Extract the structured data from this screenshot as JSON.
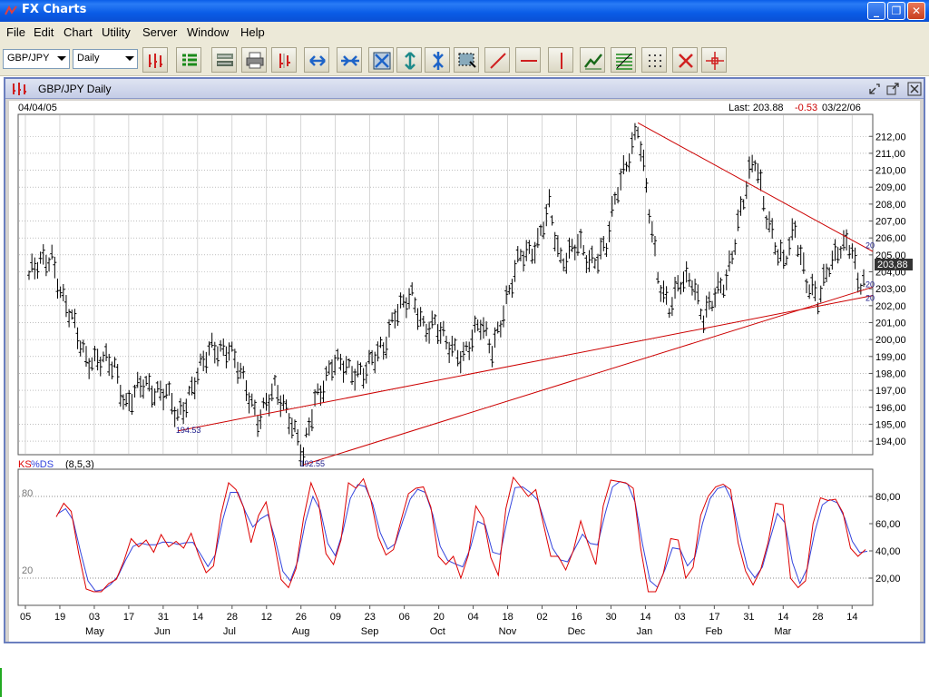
{
  "window": {
    "title": "FX Charts",
    "buttons": [
      "_",
      "❐",
      "✕"
    ]
  },
  "menu": [
    "File",
    "Edit",
    "Chart",
    "Utility",
    "Server",
    "Window",
    "Help"
  ],
  "toolbar": {
    "symbol": "GBP/JPY",
    "period": "Daily",
    "buttons": [
      "bar-chart",
      "list",
      "layout",
      "print",
      "bars",
      "expand-horizontal",
      "compress-horizontal",
      "zoom-fit",
      "expand-vertical",
      "compress-vertical",
      "select-region",
      "trend-line",
      "horizontal-line",
      "vertical-line",
      "indicator",
      "fibonacci",
      "grid",
      "delete",
      "crosshair"
    ]
  },
  "document": {
    "title": "GBP/JPY Daily"
  },
  "chart_header": {
    "start_date": "04/04/05",
    "last_label": "Last: 203.88",
    "change": "-0.53",
    "end_date": "03/22/06"
  },
  "colors": {
    "price_bars": "#000000",
    "trendlines": "#cc0000",
    "ks_line": "#dd0000",
    "ds_line": "#3344dd",
    "grid": "#999999",
    "last_box": "#333333",
    "window_border": "#6b7fbf"
  },
  "chart_data": [
    {
      "type": "ohlc",
      "title": "GBP/JPY Daily",
      "y_axis": {
        "ylim": [
          193.2,
          213.3
        ],
        "tick_labels": [
          "194,00",
          "195,00",
          "196,00",
          "197,00",
          "198,00",
          "199,00",
          "200,00",
          "201,00",
          "202,00",
          "203,00",
          "204,00",
          "205,00",
          "206,00",
          "207,00",
          "208,00",
          "209,00",
          "210,00",
          "211,00",
          "212,00"
        ],
        "position": "right"
      },
      "last_value": "203,88",
      "annotations": [
        "194.53",
        "192.55"
      ],
      "trendline_end_labels": [
        "20",
        "20",
        "20"
      ],
      "anchor_points": [
        {
          "x": 0,
          "y": 203.8
        },
        {
          "x": 8,
          "y": 205.0
        },
        {
          "x": 12,
          "y": 202.3
        },
        {
          "x": 20,
          "y": 199.0
        },
        {
          "x": 30,
          "y": 198.4
        },
        {
          "x": 34,
          "y": 196.2
        },
        {
          "x": 40,
          "y": 197.3
        },
        {
          "x": 48,
          "y": 196.9
        },
        {
          "x": 52,
          "y": 195.2
        },
        {
          "x": 58,
          "y": 197.7
        },
        {
          "x": 64,
          "y": 199.4
        },
        {
          "x": 70,
          "y": 199.6
        },
        {
          "x": 75,
          "y": 197.4
        },
        {
          "x": 80,
          "y": 195.5
        },
        {
          "x": 86,
          "y": 196.9
        },
        {
          "x": 92,
          "y": 195.3
        },
        {
          "x": 96,
          "y": 193.0
        },
        {
          "x": 100,
          "y": 196.3
        },
        {
          "x": 106,
          "y": 198.7
        },
        {
          "x": 112,
          "y": 198.1
        },
        {
          "x": 118,
          "y": 198.3
        },
        {
          "x": 124,
          "y": 199.4
        },
        {
          "x": 128,
          "y": 201.8
        },
        {
          "x": 134,
          "y": 202.3
        },
        {
          "x": 138,
          "y": 200.9
        },
        {
          "x": 142,
          "y": 201.0
        },
        {
          "x": 146,
          "y": 199.6
        },
        {
          "x": 152,
          "y": 199.2
        },
        {
          "x": 158,
          "y": 200.8
        },
        {
          "x": 162,
          "y": 199.6
        },
        {
          "x": 168,
          "y": 202.6
        },
        {
          "x": 172,
          "y": 205.1
        },
        {
          "x": 178,
          "y": 205.6
        },
        {
          "x": 182,
          "y": 207.7
        },
        {
          "x": 186,
          "y": 204.8
        },
        {
          "x": 192,
          "y": 205.5
        },
        {
          "x": 196,
          "y": 204.6
        },
        {
          "x": 202,
          "y": 205.6
        },
        {
          "x": 206,
          "y": 208.8
        },
        {
          "x": 210,
          "y": 211.1
        },
        {
          "x": 213,
          "y": 212.6
        },
        {
          "x": 216,
          "y": 208.7
        },
        {
          "x": 220,
          "y": 203.8
        },
        {
          "x": 224,
          "y": 202.0
        },
        {
          "x": 228,
          "y": 203.2
        },
        {
          "x": 232,
          "y": 203.6
        },
        {
          "x": 236,
          "y": 201.4
        },
        {
          "x": 240,
          "y": 202.4
        },
        {
          "x": 244,
          "y": 203.6
        },
        {
          "x": 248,
          "y": 206.9
        },
        {
          "x": 252,
          "y": 209.5
        },
        {
          "x": 254,
          "y": 210.6
        },
        {
          "x": 258,
          "y": 207.6
        },
        {
          "x": 262,
          "y": 205.0
        },
        {
          "x": 264,
          "y": 204.3
        },
        {
          "x": 268,
          "y": 206.7
        },
        {
          "x": 272,
          "y": 203.5
        },
        {
          "x": 276,
          "y": 202.0
        },
        {
          "x": 280,
          "y": 204.6
        },
        {
          "x": 284,
          "y": 205.6
        },
        {
          "x": 288,
          "y": 205.2
        },
        {
          "x": 290,
          "y": 203.2
        },
        {
          "x": 292,
          "y": 203.8
        }
      ]
    },
    {
      "type": "line",
      "title": "KS%DS (8,5,3)",
      "legend": [
        "KS",
        "%DS",
        "(8,5,3)"
      ],
      "y_axis": {
        "ylim": [
          0,
          100
        ],
        "tick_labels": [
          "20,00",
          "40,00",
          "60,00",
          "80,00"
        ],
        "left_labels": [
          "80",
          "20"
        ],
        "reference_lines": [
          20,
          80
        ]
      },
      "series": [
        {
          "name": "KS",
          "values": [
            65,
            75,
            69,
            38,
            12,
            10,
            10,
            16,
            19,
            32,
            49,
            43,
            48,
            39,
            52,
            43,
            47,
            42,
            53,
            37,
            24,
            29,
            67,
            90,
            85,
            72,
            46,
            66,
            76,
            49,
            19,
            13,
            27,
            64,
            90,
            76,
            38,
            30,
            48,
            90,
            86,
            93,
            77,
            50,
            37,
            41,
            62,
            82,
            86,
            87,
            72,
            36,
            30,
            36,
            20,
            37,
            73,
            64,
            35,
            22,
            71,
            94,
            87,
            80,
            85,
            60,
            36,
            36,
            26,
            40,
            62,
            45,
            30,
            73,
            92,
            91,
            90,
            86,
            42,
            10,
            10,
            23,
            49,
            48,
            20,
            28,
            66,
            80,
            87,
            89,
            85,
            46,
            25,
            15,
            26,
            46,
            75,
            74,
            20,
            13,
            18,
            60,
            79,
            77,
            78,
            68,
            42,
            36,
            41
          ]
        }
      ],
      "x_axis": {
        "tick_labels": [
          "05",
          "19",
          "03",
          "17",
          "31",
          "14",
          "28",
          "12",
          "26",
          "09",
          "23",
          "06",
          "20",
          "04",
          "18",
          "02",
          "16",
          "30",
          "14",
          "03",
          "17",
          "31",
          "14",
          "28",
          "14"
        ],
        "month_labels": [
          "May",
          "Jun",
          "Jul",
          "Aug",
          "Sep",
          "Oct",
          "Nov",
          "Dec",
          "Jan",
          "Feb",
          "Mar"
        ]
      }
    }
  ]
}
